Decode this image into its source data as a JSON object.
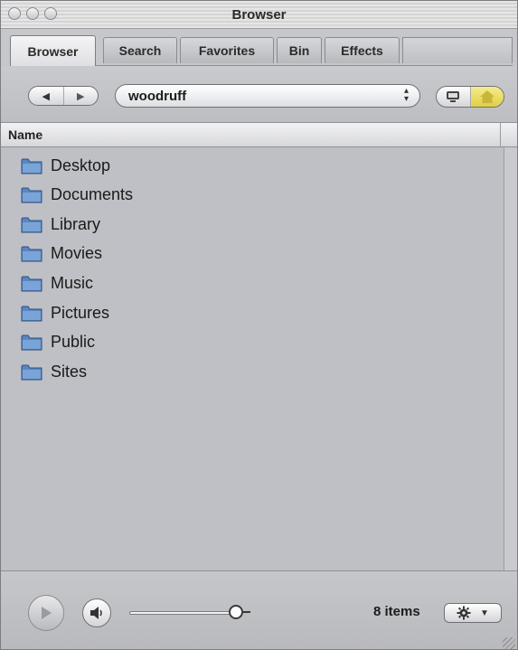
{
  "window": {
    "title": "Browser"
  },
  "tabs": [
    {
      "label": "Browser",
      "active": true
    },
    {
      "label": "Search",
      "active": false
    },
    {
      "label": "Favorites",
      "active": false
    },
    {
      "label": "Bin",
      "active": false
    },
    {
      "label": "Effects",
      "active": false
    }
  ],
  "toolbar": {
    "location": "woodruff",
    "back_icon": "back-arrow-icon",
    "forward_icon": "forward-arrow-icon",
    "view_buttons": [
      "computer-icon",
      "home-icon"
    ]
  },
  "list": {
    "column_header": "Name",
    "items": [
      {
        "label": "Desktop",
        "icon": "folder-icon"
      },
      {
        "label": "Documents",
        "icon": "folder-icon"
      },
      {
        "label": "Library",
        "icon": "folder-icon"
      },
      {
        "label": "Movies",
        "icon": "folder-icon"
      },
      {
        "label": "Music",
        "icon": "folder-icon"
      },
      {
        "label": "Pictures",
        "icon": "folder-icon"
      },
      {
        "label": "Public",
        "icon": "folder-icon"
      },
      {
        "label": "Sites",
        "icon": "folder-icon"
      }
    ]
  },
  "footer": {
    "item_count": "8 items",
    "volume_level": 0.93
  },
  "colors": {
    "home_highlight": "#e6d74d",
    "folder_blue": "#5a86c2"
  }
}
